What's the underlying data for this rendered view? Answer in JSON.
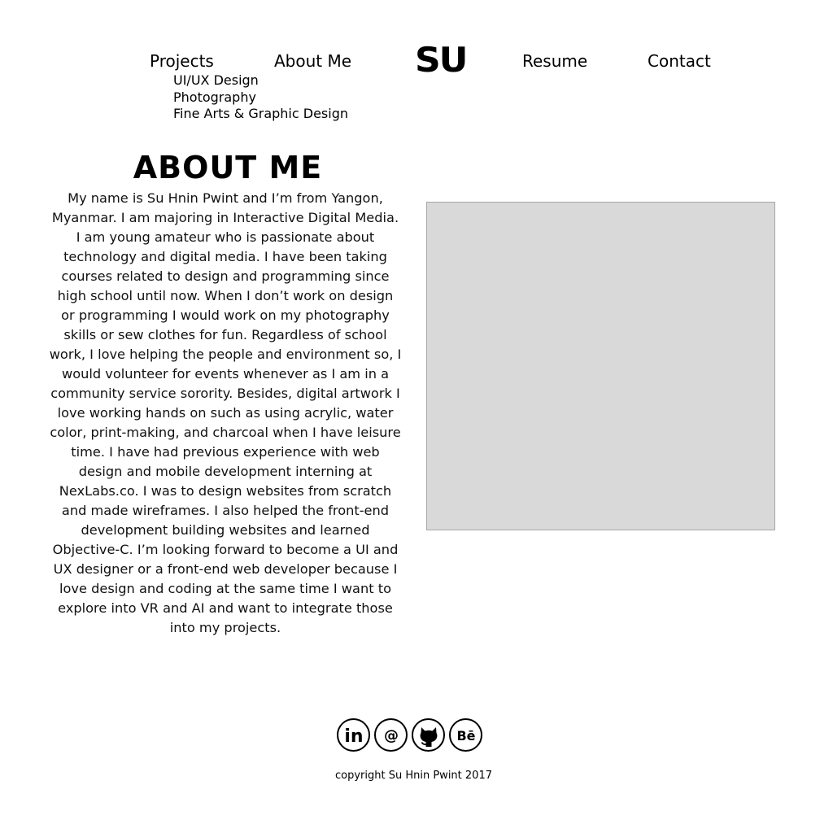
{
  "nav": {
    "projects": "Projects",
    "about": "About Me",
    "logo": "SU",
    "resume": "Resume",
    "contact": "Contact",
    "projects_submenu": [
      "UI/UX Design",
      "Photography",
      "Fine Arts & Graphic Design"
    ]
  },
  "about": {
    "title": "ABOUT ME",
    "bio": "My name is Su Hnin Pwint and I’m from Yangon, Myanmar. I am majoring in Interactive Digital Media. I am young amateur who is passionate about technology and digital media. I have been taking courses related to design and programming since high school until now. When I don’t work on design or programming I would work on my photography skills or sew clothes for fun. Regardless of school work, I love helping the people and environment so, I would volunteer for events whenever as I am in a community service sorority. Besides, digital artwork I love working hands on such as using acrylic, water color, print-making, and charcoal when I have leisure time. I have had previous experience with web design and mobile development interning at NexLabs.co. I was to design websites from scratch and made wireframes. I also helped the front-end development building websites and learned Objective-C. I’m looking forward to become a UI and UX designer or a front-end web developer because I love design and coding at the same time I want to explore into VR and AI and want to integrate those into my projects."
  },
  "social": {
    "icons": [
      "linkedin-icon",
      "at-email-icon",
      "github-icon",
      "behance-icon"
    ],
    "linkedin_glyph": "in",
    "email_glyph": "@",
    "behance_glyph": "Bē"
  },
  "footer": {
    "copyright": "copyright Su Hnin Pwint 2017"
  },
  "colors": {
    "text": "#000000",
    "background": "#ffffff",
    "photo_placeholder": "#d9d9d9",
    "photo_border": "#a6a6a6"
  }
}
